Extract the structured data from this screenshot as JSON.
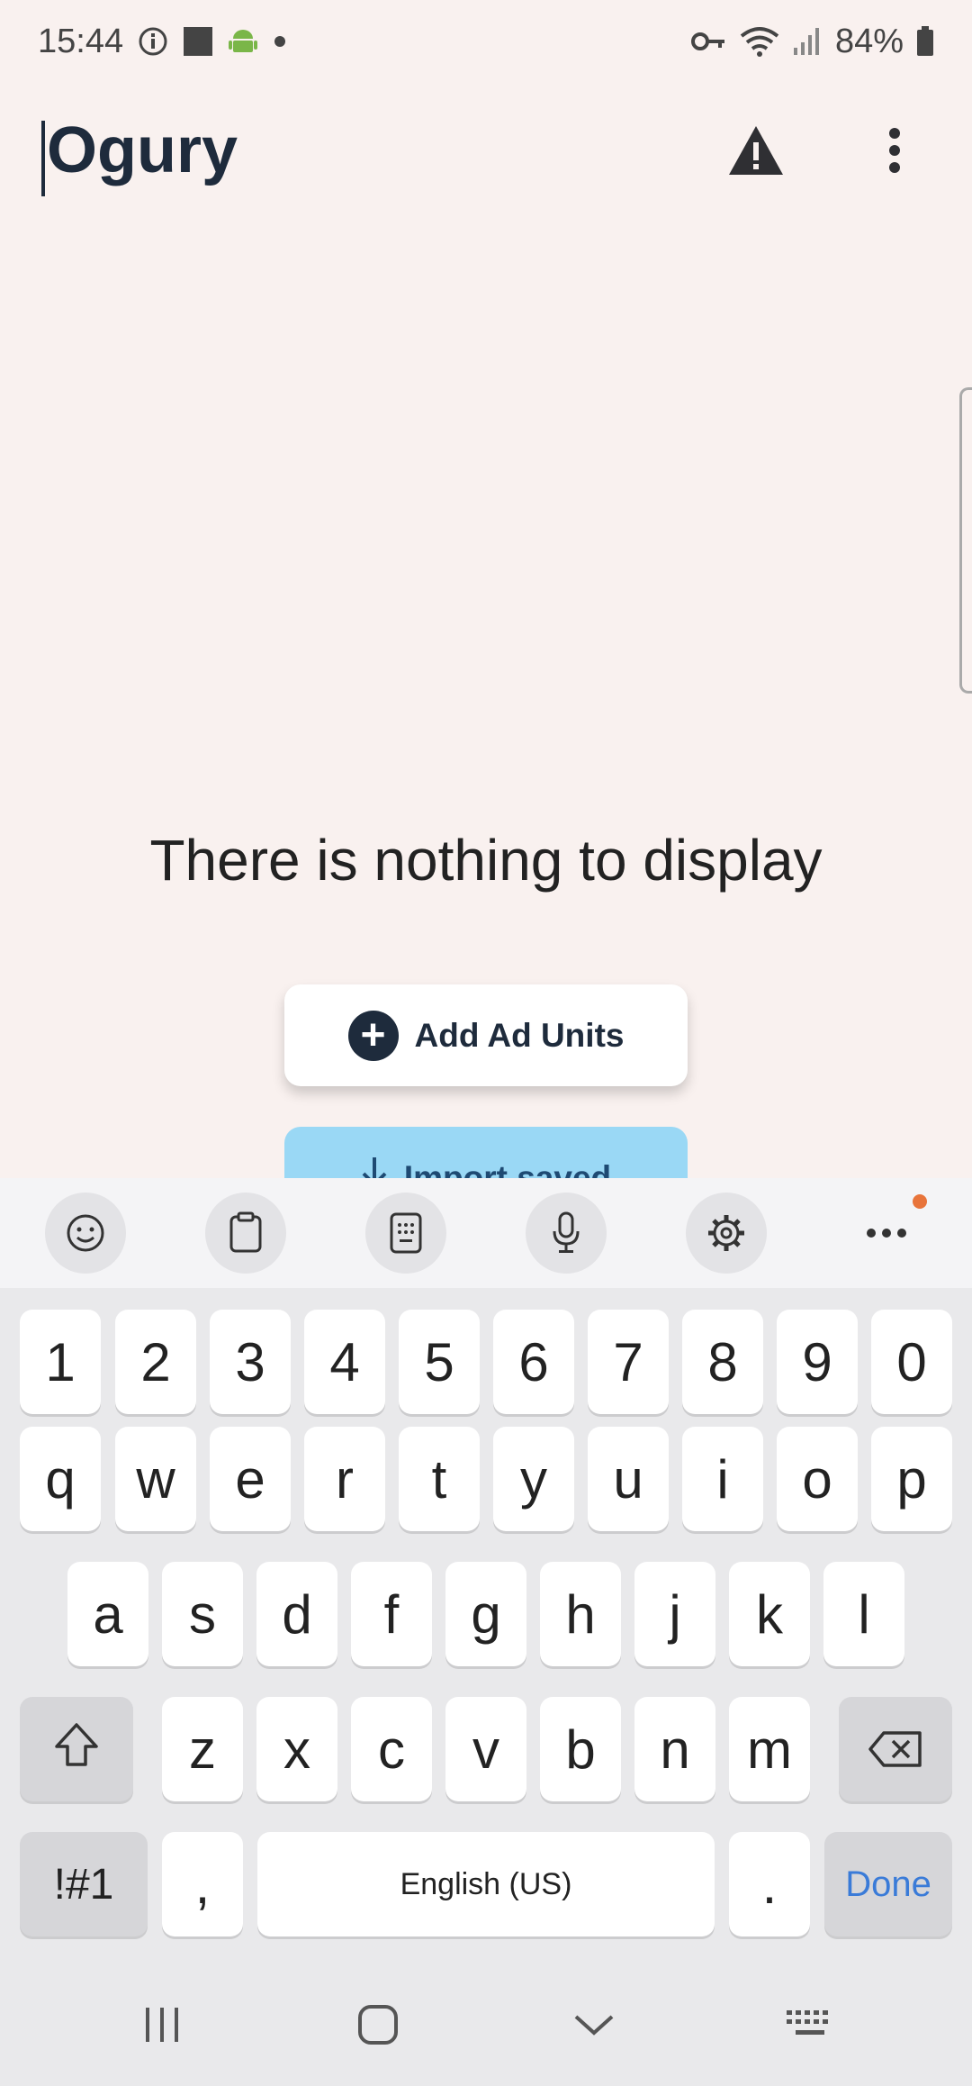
{
  "status_bar": {
    "time": "15:44",
    "battery": "84%"
  },
  "header": {
    "title": "Ogury"
  },
  "main": {
    "empty_message": "There is nothing to display",
    "add_button_label": "Add Ad Units",
    "import_button_label": "Import saved"
  },
  "keyboard": {
    "row_numbers": [
      "1",
      "2",
      "3",
      "4",
      "5",
      "6",
      "7",
      "8",
      "9",
      "0"
    ],
    "row_top": [
      "q",
      "w",
      "e",
      "r",
      "t",
      "y",
      "u",
      "i",
      "o",
      "p"
    ],
    "row_mid": [
      "a",
      "s",
      "d",
      "f",
      "g",
      "h",
      "j",
      "k",
      "l"
    ],
    "row_bottom": [
      "z",
      "x",
      "c",
      "v",
      "b",
      "n",
      "m"
    ],
    "symbols_label": "!#1",
    "comma_label": ",",
    "space_label": "English (US)",
    "period_label": ".",
    "done_label": "Done",
    "toolbar_icons": [
      "emoji-icon",
      "clipboard-icon",
      "keypad-icon",
      "microphone-icon",
      "settings-icon",
      "more-icon"
    ]
  },
  "colors": {
    "background": "#f9f1ef",
    "title": "#1e2b3c",
    "import_button": "#9ad8f5",
    "done_key": "#3a7bd8",
    "notification_dot": "#e8743b"
  }
}
